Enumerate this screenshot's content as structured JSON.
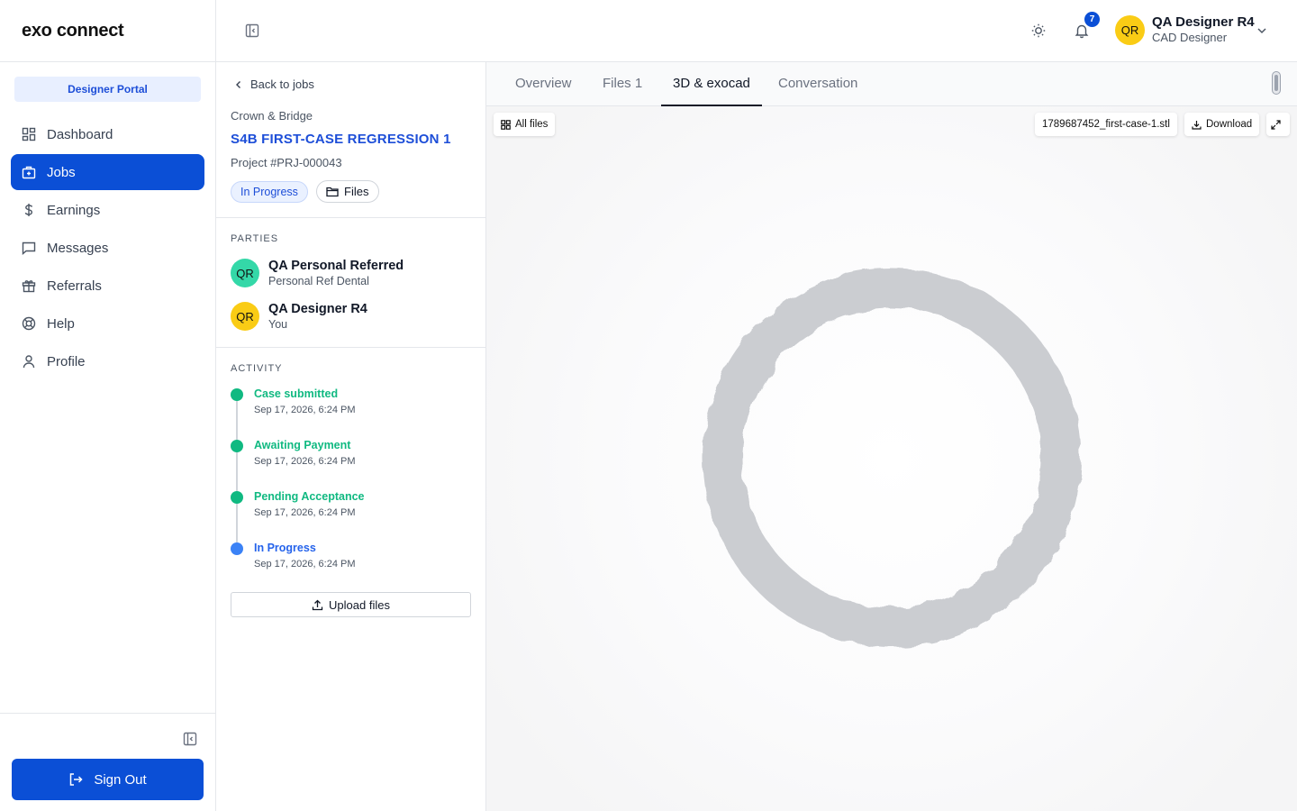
{
  "brand": {
    "name": "exo connect"
  },
  "sidebar": {
    "portal_label": "Designer Portal",
    "items": [
      {
        "label": "Dashboard",
        "icon": "dashboard-icon",
        "active": false
      },
      {
        "label": "Jobs",
        "icon": "briefcase-icon",
        "active": true
      },
      {
        "label": "Earnings",
        "icon": "dollar-icon",
        "active": false
      },
      {
        "label": "Messages",
        "icon": "message-icon",
        "active": false
      },
      {
        "label": "Referrals",
        "icon": "gift-icon",
        "active": false
      },
      {
        "label": "Help",
        "icon": "lifebuoy-icon",
        "active": false
      },
      {
        "label": "Profile",
        "icon": "user-icon",
        "active": false
      }
    ],
    "sign_out_label": "Sign Out"
  },
  "header": {
    "notification_count": "7",
    "user": {
      "initials": "QR",
      "name": "QA Designer R4",
      "role": "CAD Designer"
    }
  },
  "job": {
    "back_label": "Back to jobs",
    "category": "Crown & Bridge",
    "title": "S4B FIRST-CASE REGRESSION 1",
    "project_number": "Project #PRJ-000043",
    "status": "In Progress",
    "files_label": "Files"
  },
  "parties": {
    "label": "PARTIES",
    "items": [
      {
        "initials": "QR",
        "name": "QA Personal Referred",
        "subtitle": "Personal Ref Dental",
        "color": "#34d8a8"
      },
      {
        "initials": "QR",
        "name": "QA Designer R4",
        "subtitle": "You",
        "color": "#facc15"
      }
    ]
  },
  "activity": {
    "label": "ACTIVITY",
    "items": [
      {
        "title": "Case submitted",
        "time": "Sep 17, 2026, 6:24 PM",
        "color": "#10b981"
      },
      {
        "title": "Awaiting Payment",
        "time": "Sep 17, 2026, 6:24 PM",
        "color": "#10b981"
      },
      {
        "title": "Pending Acceptance",
        "time": "Sep 17, 2026, 6:24 PM",
        "color": "#10b981"
      },
      {
        "title": "In Progress",
        "time": "Sep 17, 2026, 6:24 PM",
        "color": "#3b82f6"
      }
    ],
    "upload_label": "Upload files"
  },
  "viewer": {
    "tabs": [
      {
        "label": "Overview",
        "active": false
      },
      {
        "label": "Files 1",
        "active": false
      },
      {
        "label": "3D & exocad",
        "active": true
      },
      {
        "label": "Conversation",
        "active": false
      }
    ],
    "all_files_label": "All files",
    "file_name": "1789687452_first-case-1.stl",
    "download_label": "Download",
    "model_color": "#cbcdd1"
  }
}
